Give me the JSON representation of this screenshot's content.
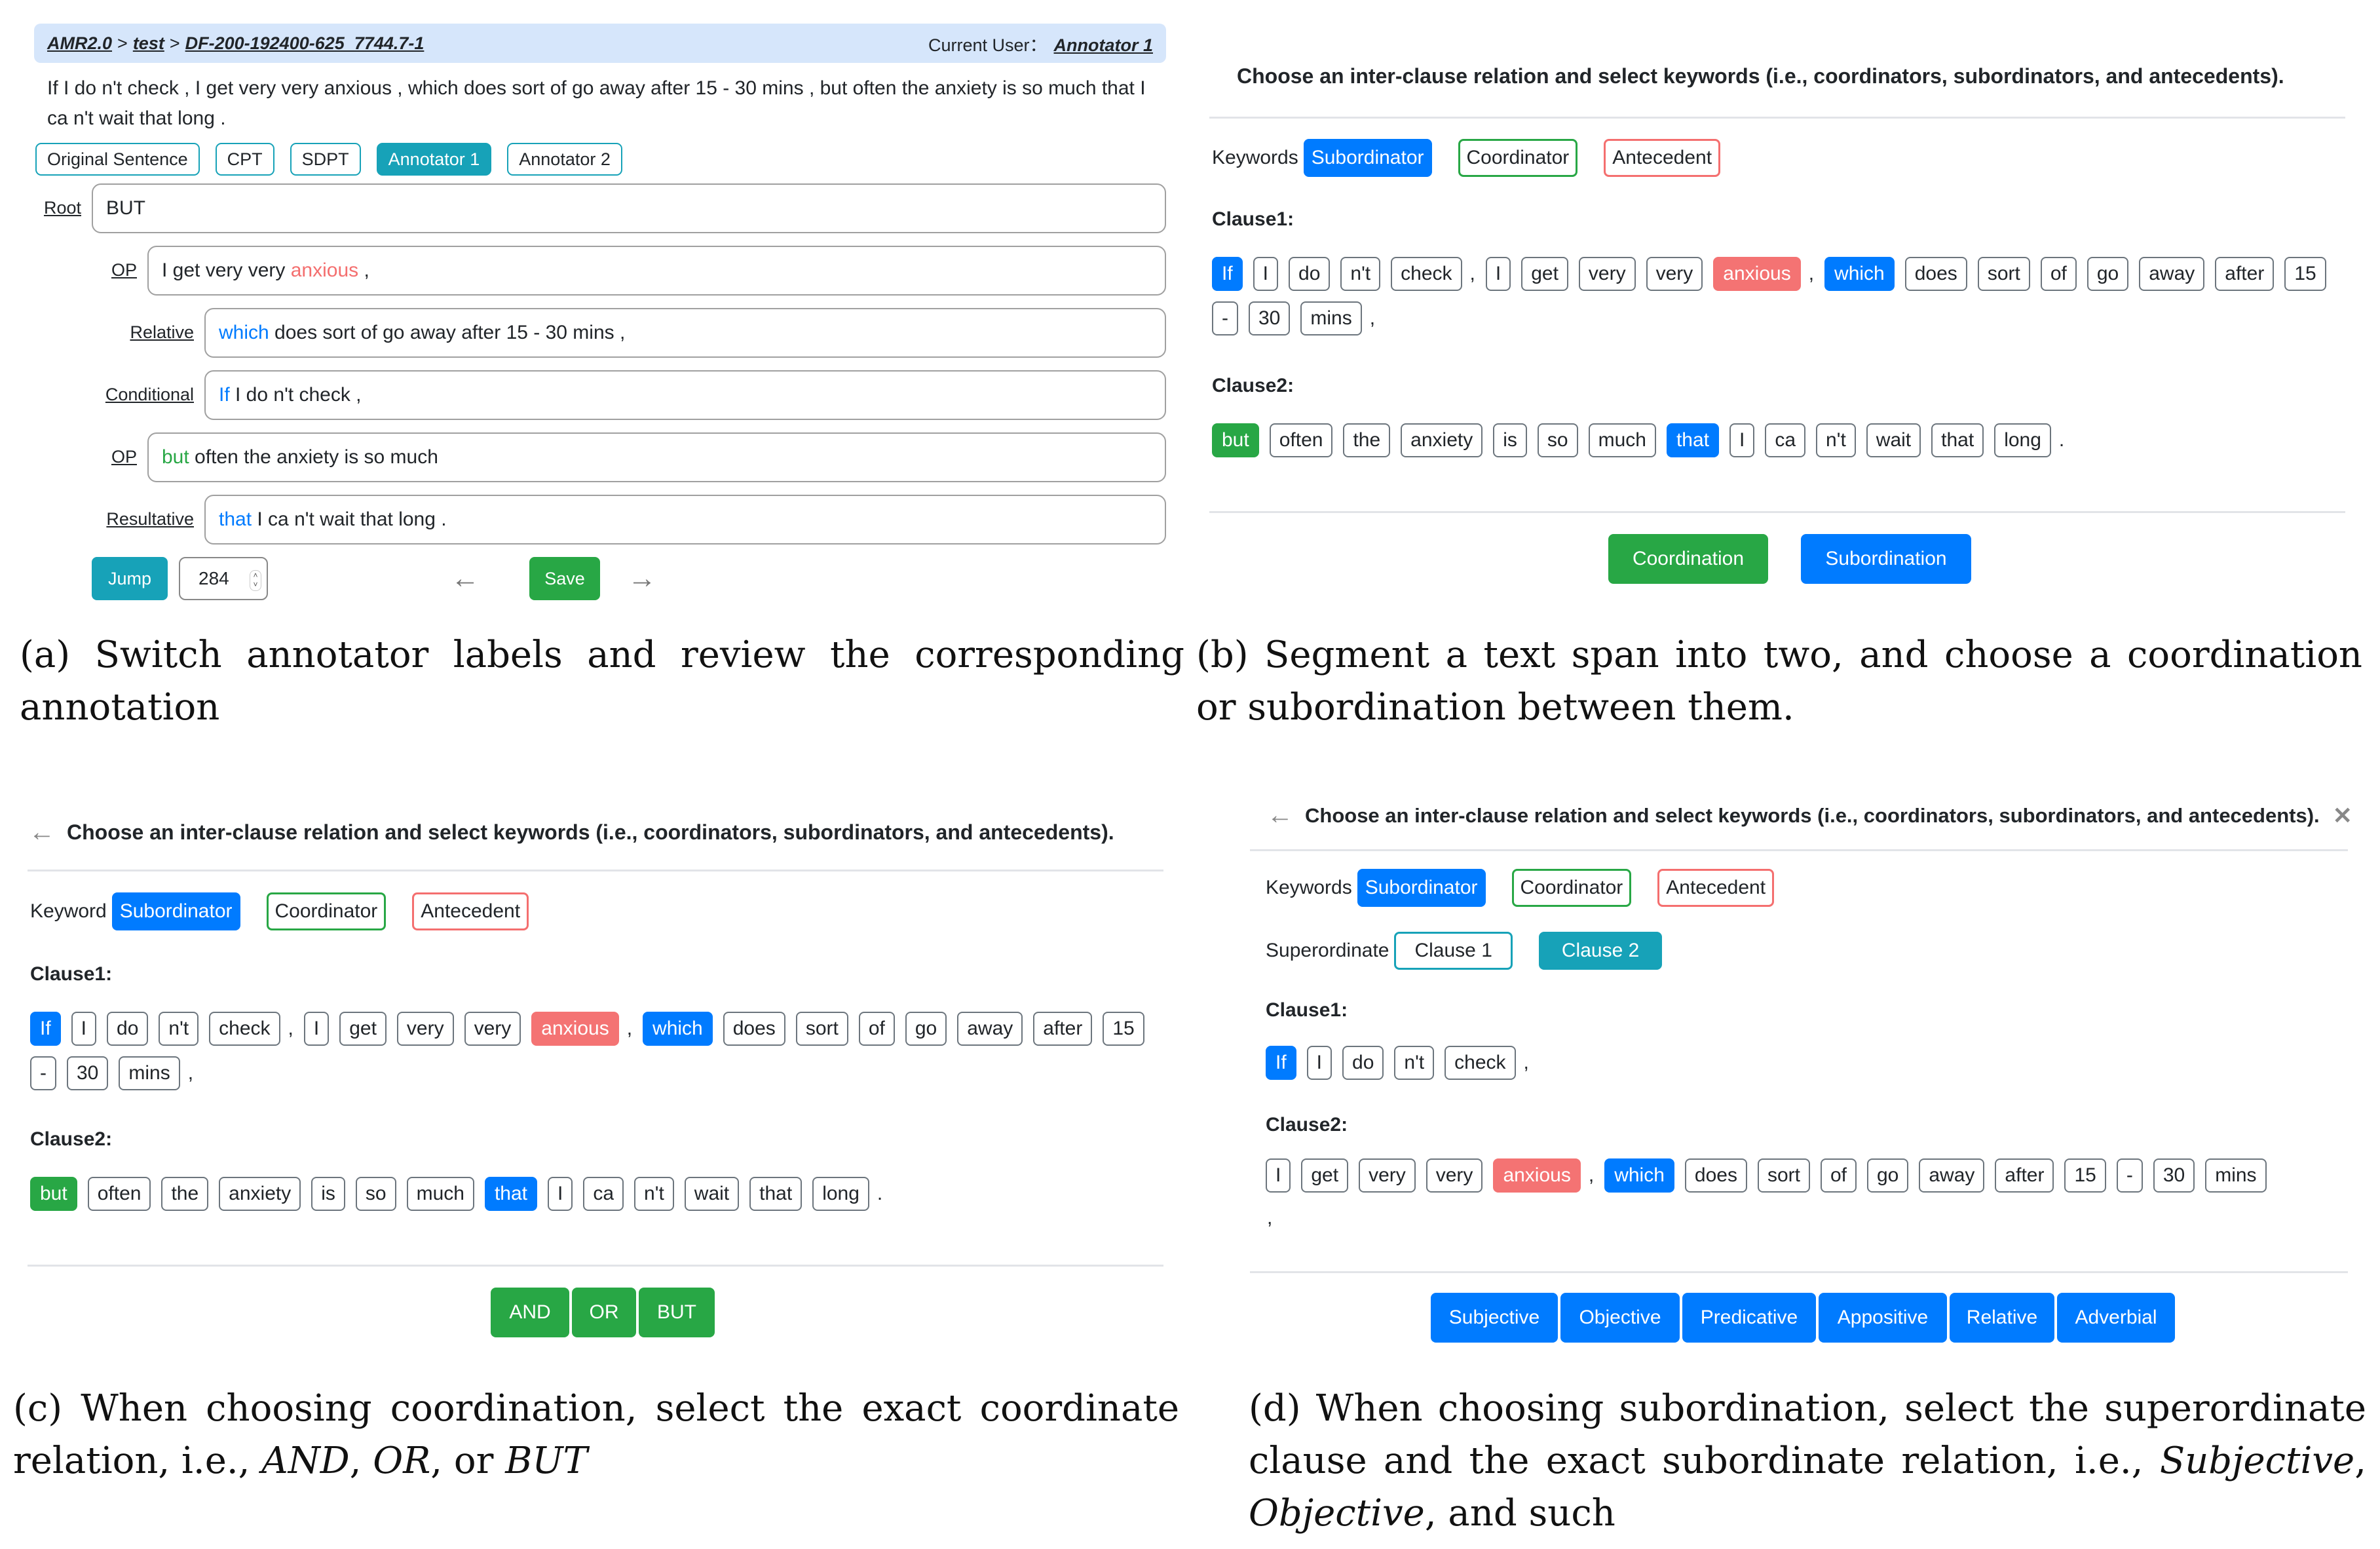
{
  "panel_a": {
    "breadcrumb": [
      "AMR2.0",
      "test",
      "DF-200-192400-625_7744.7-1"
    ],
    "breadcrumb_sep": ">",
    "current_user_label": "Current User：",
    "current_user": "Annotator 1",
    "sentence": "If I do n't check , I get very very anxious , which does sort of go away after 15 - 30 mins , but often the anxiety is so much that I ca n't wait that long .",
    "tabs": [
      {
        "label": "Original Sentence",
        "active": false
      },
      {
        "label": "CPT",
        "active": false
      },
      {
        "label": "SDPT",
        "active": false
      },
      {
        "label": "Annotator 1",
        "active": true
      },
      {
        "label": "Annotator 2",
        "active": false
      }
    ],
    "rows": [
      {
        "label": "Root",
        "keyword": "",
        "keyword_color": "",
        "pre": "",
        "text": "BUT",
        "post": ""
      },
      {
        "label": "OP",
        "pre": "I get very very ",
        "keyword": "anxious",
        "keyword_color": "red",
        "post": " ,"
      },
      {
        "label": "Relative",
        "pre": "",
        "keyword": "which",
        "keyword_color": "blue",
        "post": " does sort of go away after 15 - 30 mins ,"
      },
      {
        "label": "Conditional",
        "pre": "",
        "keyword": "If",
        "keyword_color": "blue",
        "post": " I do n't check ,"
      },
      {
        "label": "OP",
        "pre": "",
        "keyword": "but",
        "keyword_color": "green",
        "post": " often the anxiety is so much"
      },
      {
        "label": "Resultative",
        "pre": "",
        "keyword": "that",
        "keyword_color": "blue",
        "post": " I ca n't wait that long ."
      }
    ],
    "jump_label": "Jump",
    "jump_value": "284",
    "save_label": "Save",
    "prev_icon": "←",
    "next_icon": "→"
  },
  "panel_b": {
    "title": "Choose an inter-clause relation and select keywords (i.e., coordinators, subordinators, and antecedents).",
    "keywords_label": "Keywords",
    "keyword_types": [
      "Subordinator",
      "Coordinator",
      "Antecedent"
    ],
    "clause1_label": "Clause1:",
    "clause1_tokens": [
      {
        "t": "If",
        "s": "blue"
      },
      {
        "t": "I"
      },
      {
        "t": "do"
      },
      {
        "t": "n't"
      },
      {
        "t": "check"
      },
      {
        "t": ",",
        "p": true
      },
      {
        "t": "I"
      },
      {
        "t": "get"
      },
      {
        "t": "very"
      },
      {
        "t": "very"
      },
      {
        "t": "anxious",
        "s": "red"
      },
      {
        "t": ",",
        "p": true
      },
      {
        "t": "which",
        "s": "blue"
      },
      {
        "t": "does"
      },
      {
        "t": "sort"
      },
      {
        "t": "of"
      },
      {
        "t": "go"
      },
      {
        "t": "away"
      },
      {
        "t": "after"
      },
      {
        "t": "15"
      },
      {
        "t": "-"
      },
      {
        "t": "30"
      },
      {
        "t": "mins"
      },
      {
        "t": ",",
        "p": true
      }
    ],
    "clause2_label": "Clause2:",
    "clause2_tokens": [
      {
        "t": "but",
        "s": "green"
      },
      {
        "t": "often"
      },
      {
        "t": "the"
      },
      {
        "t": "anxiety"
      },
      {
        "t": "is"
      },
      {
        "t": "so"
      },
      {
        "t": "much"
      },
      {
        "t": "that",
        "s": "blue"
      },
      {
        "t": "I"
      },
      {
        "t": "ca"
      },
      {
        "t": "n't"
      },
      {
        "t": "wait"
      },
      {
        "t": "that"
      },
      {
        "t": "long"
      },
      {
        "t": ".",
        "p": true
      }
    ],
    "buttons": [
      "Coordination",
      "Subordination"
    ]
  },
  "panel_c": {
    "title": "Choose an inter-clause relation and select keywords (i.e., coordinators, subordinators, and antecedents).",
    "back_icon": "←",
    "keywords_label": "Keyword",
    "keyword_types": [
      "Subordinator",
      "Coordinator",
      "Antecedent"
    ],
    "clause1_label": "Clause1:",
    "clause1_tokens": [
      {
        "t": "If",
        "s": "blue"
      },
      {
        "t": "I"
      },
      {
        "t": "do"
      },
      {
        "t": "n't"
      },
      {
        "t": "check"
      },
      {
        "t": ",",
        "p": true
      },
      {
        "t": "I"
      },
      {
        "t": "get"
      },
      {
        "t": "very"
      },
      {
        "t": "very"
      },
      {
        "t": "anxious",
        "s": "red"
      },
      {
        "t": ",",
        "p": true
      },
      {
        "t": "which",
        "s": "blue"
      },
      {
        "t": "does"
      },
      {
        "t": "sort"
      },
      {
        "t": "of"
      },
      {
        "t": "go"
      },
      {
        "t": "away"
      },
      {
        "t": "after"
      },
      {
        "t": "15"
      },
      {
        "t": "-"
      },
      {
        "t": "30"
      },
      {
        "t": "mins"
      },
      {
        "t": ",",
        "p": true
      }
    ],
    "clause2_label": "Clause2:",
    "clause2_tokens": [
      {
        "t": "but",
        "s": "green"
      },
      {
        "t": "often"
      },
      {
        "t": "the"
      },
      {
        "t": "anxiety"
      },
      {
        "t": "is"
      },
      {
        "t": "so"
      },
      {
        "t": "much"
      },
      {
        "t": "that",
        "s": "blue"
      },
      {
        "t": "I"
      },
      {
        "t": "ca"
      },
      {
        "t": "n't"
      },
      {
        "t": "wait"
      },
      {
        "t": "that"
      },
      {
        "t": "long"
      },
      {
        "t": ".",
        "p": true
      }
    ],
    "buttons": [
      "AND",
      "OR",
      "BUT"
    ]
  },
  "panel_d": {
    "title": "Choose an inter-clause relation and select keywords (i.e., coordinators, subordinators, and antecedents).",
    "back_icon": "←",
    "close_icon": "✕",
    "keywords_label": "Keywords",
    "keyword_types": [
      "Subordinator",
      "Coordinator",
      "Antecedent"
    ],
    "superordinate_label": "Superordinate",
    "superordinate_options": [
      {
        "label": "Clause 1",
        "active": false
      },
      {
        "label": "Clause 2",
        "active": true
      }
    ],
    "clause1_label": "Clause1:",
    "clause1_tokens": [
      {
        "t": "If",
        "s": "blue"
      },
      {
        "t": "I"
      },
      {
        "t": "do"
      },
      {
        "t": "n't"
      },
      {
        "t": "check"
      },
      {
        "t": ",",
        "p": true
      }
    ],
    "clause2_label": "Clause2:",
    "clause2_tokens": [
      {
        "t": "I"
      },
      {
        "t": "get"
      },
      {
        "t": "very"
      },
      {
        "t": "very"
      },
      {
        "t": "anxious",
        "s": "red"
      },
      {
        "t": ",",
        "p": true
      },
      {
        "t": "which",
        "s": "blue"
      },
      {
        "t": "does"
      },
      {
        "t": "sort"
      },
      {
        "t": "of"
      },
      {
        "t": "go"
      },
      {
        "t": "away"
      },
      {
        "t": "after"
      },
      {
        "t": "15"
      },
      {
        "t": "-"
      },
      {
        "t": "30"
      },
      {
        "t": "mins"
      }
    ],
    "clause2_trailing": ",",
    "buttons": [
      "Subjective",
      "Objective",
      "Predicative",
      "Appositive",
      "Relative",
      "Adverbial"
    ]
  },
  "captions": {
    "a": "(a)  Switch annotator labels and review the corresponding annotation",
    "b": "(b)  Segment a text span into two, and choose a coordination or subordination between them.",
    "c_pre": "(c)  When choosing coordination, select the exact coordinate relation, i.e., ",
    "c_items": [
      "AND",
      "OR",
      "BUT"
    ],
    "d_pre": "(d)  When choosing subordination, select the superordinate clause and the exact subordinate relation, i.e., ",
    "d_items": [
      "Subjective",
      "Objective"
    ],
    "d_post": ", and such"
  },
  "colors": {
    "teal": "#17a2b8",
    "blue": "#007bff",
    "green": "#28a745",
    "red": "#f47373",
    "header_bg": "#d6e6fb"
  }
}
